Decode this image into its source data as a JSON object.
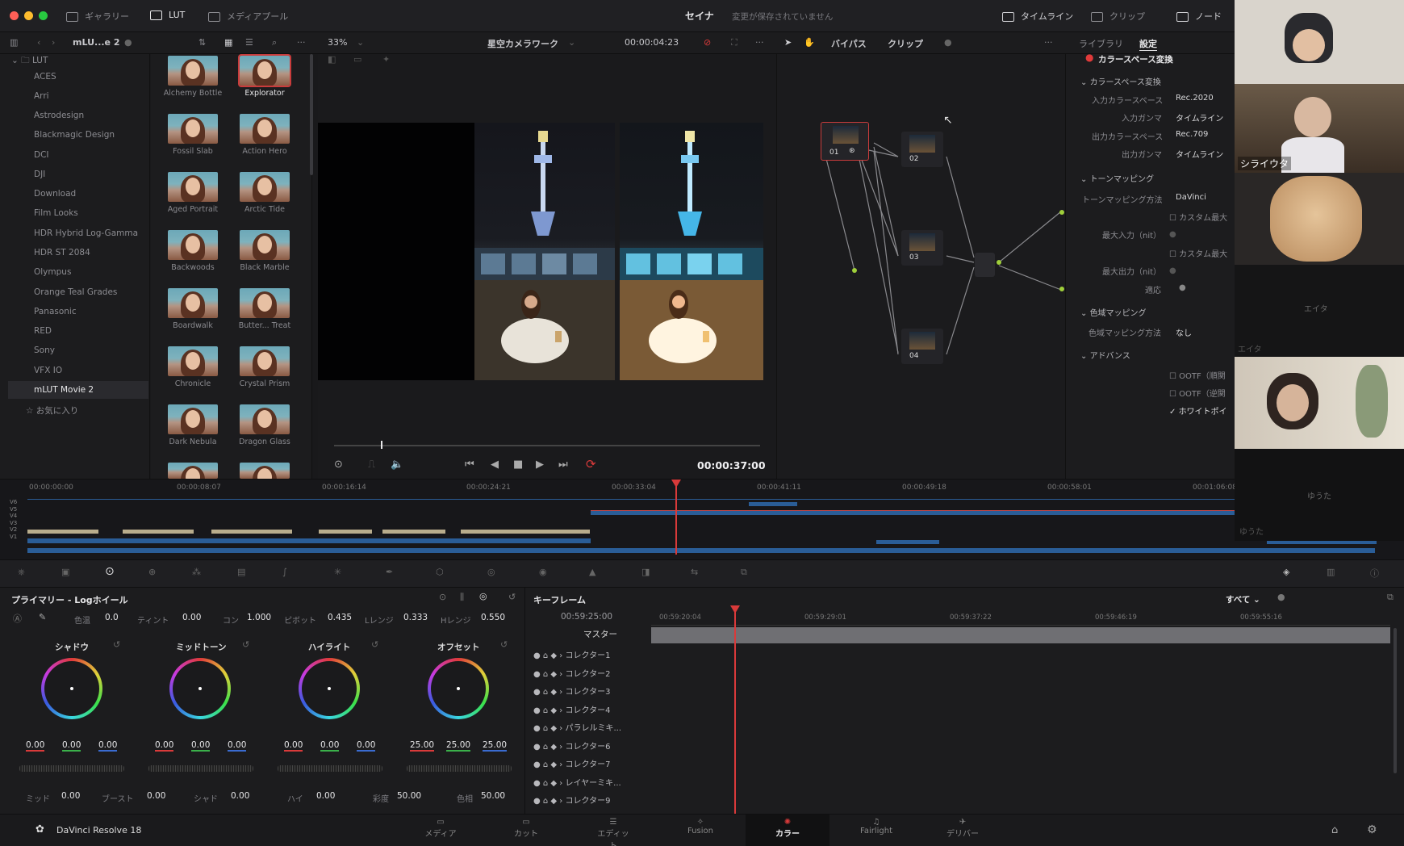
{
  "window": {
    "title": "セイナ",
    "save_status": "変更が保存されていません",
    "left_tabs": [
      "ギャラリー",
      "LUT",
      "メディアプール"
    ],
    "right_tabs": [
      "タイムライン",
      "クリップ",
      "ノード"
    ]
  },
  "subbar": {
    "project_short": "mLU...e 2",
    "zoom": "33%",
    "timeline_name": "星空カメラワーク",
    "timecode": "00:00:04:23",
    "bypass": "バイパス",
    "clip": "クリップ",
    "library_tab": "ライブラリ",
    "settings_tab": "設定"
  },
  "lut_tree": {
    "root": "LUT",
    "items": [
      "ACES",
      "Arri",
      "Astrodesign",
      "Blackmagic Design",
      "DCI",
      "DJI",
      "Download",
      "Film Looks",
      "HDR Hybrid Log-Gamma",
      "HDR ST 2084",
      "Olympus",
      "Orange Teal Grades",
      "Panasonic",
      "RED",
      "Sony",
      "VFX IO",
      "mLUT Movie 2"
    ],
    "favorites": "お気に入り",
    "selected": "mLUT Movie 2"
  },
  "lut_grid": [
    [
      "Alchemy Bottle",
      "Explorator"
    ],
    [
      "Fossil Slab",
      "Action Hero"
    ],
    [
      "Aged Portrait",
      "Arctic Tide"
    ],
    [
      "Backwoods",
      "Black Marble"
    ],
    [
      "Boardwalk",
      "Butter... Treat"
    ],
    [
      "Chronicle",
      "Crystal Prism"
    ],
    [
      "Dark Nebula",
      "Dragon Glass"
    ]
  ],
  "viewer": {
    "timecode": "00:00:37:00"
  },
  "nodes": [
    "01",
    "02",
    "03",
    "04"
  ],
  "settings_panel": {
    "header": "カラースペース変換",
    "section_csc": "カラースペース変換",
    "input_cs_label": "入力カラースペース",
    "input_cs_value": "Rec.2020",
    "input_gamma_label": "入力ガンマ",
    "input_gamma_value": "タイムライン",
    "output_cs_label": "出力カラースペース",
    "output_cs_value": "Rec.709",
    "output_gamma_label": "出力ガンマ",
    "output_gamma_value": "タイムライン",
    "section_tone": "トーンマッピング",
    "tone_method_label": "トーンマッピング方法",
    "tone_method_value": "DaVinci",
    "custom_max_in": "カスタム最大",
    "max_in_label": "最大入力（nit）",
    "custom_max_out": "カスタム最大",
    "max_out_label": "最大出力（nit）",
    "adapt_label": "適応",
    "section_gamut": "色域マッピング",
    "gamut_method_label": "色域マッピング方法",
    "gamut_method_value": "なし",
    "section_adv": "アドバンス",
    "ootf1": "OOTF（順関",
    "ootf2": "OOTF（逆関",
    "white_point": "ホワイトポイ"
  },
  "timeline": {
    "ruler": [
      "00:00:00:00",
      "00:00:08:07",
      "00:00:16:14",
      "00:00:24:21",
      "00:00:33:04",
      "00:00:41:11",
      "00:00:49:18",
      "00:00:58:01",
      "00:01:06:08"
    ],
    "tracks": [
      "V6",
      "V5",
      "V4",
      "V3",
      "V2",
      "V1"
    ]
  },
  "primaries": {
    "title": "プライマリー - Logホイール",
    "params": [
      {
        "label": "色温",
        "value": "0.0"
      },
      {
        "label": "ティント",
        "value": "0.00"
      },
      {
        "label": "コン",
        "value": "1.000"
      },
      {
        "label": "ピボット",
        "value": "0.435"
      },
      {
        "label": "Lレンジ",
        "value": "0.333"
      },
      {
        "label": "Hレンジ",
        "value": "0.550"
      }
    ],
    "wheels": [
      {
        "name": "シャドウ",
        "values": [
          "0.00",
          "0.00",
          "0.00"
        ]
      },
      {
        "name": "ミッドトーン",
        "values": [
          "0.00",
          "0.00",
          "0.00"
        ]
      },
      {
        "name": "ハイライト",
        "values": [
          "0.00",
          "0.00",
          "0.00"
        ]
      },
      {
        "name": "オフセット",
        "values": [
          "25.00",
          "25.00",
          "25.00"
        ]
      }
    ],
    "bottom": [
      {
        "label": "ミッド",
        "value": "0.00"
      },
      {
        "label": "ブースト",
        "value": "0.00"
      },
      {
        "label": "シャド",
        "value": "0.00"
      },
      {
        "label": "ハイ",
        "value": "0.00"
      },
      {
        "label": "彩度",
        "value": "50.00"
      },
      {
        "label": "色相",
        "value": "50.00"
      }
    ]
  },
  "keyframes": {
    "title": "キーフレーム",
    "filter": "すべて",
    "timecode": "00:59:25:00",
    "ruler": [
      "00:59:20:04",
      "00:59:29:01",
      "00:59:37:22",
      "00:59:46:19",
      "00:59:55:16"
    ],
    "master": "マスター",
    "rows": [
      "コレクター1",
      "コレクター2",
      "コレクター3",
      "コレクター4",
      "パラレルミキ...",
      "コレクター6",
      "コレクター7",
      "レイヤーミキ...",
      "コレクター9"
    ]
  },
  "pages": {
    "app_name": "DaVinci Resolve 18",
    "tabs": [
      "メディア",
      "カット",
      "エディット",
      "Fusion",
      "カラー",
      "Fairlight",
      "デリバー"
    ],
    "active": "カラー"
  },
  "participants": {
    "p2_name": "シライウタ",
    "n1": "エイタ",
    "n2": "エイタ",
    "n3": "ゆうた",
    "n4": "ゆうた"
  },
  "colors": {
    "accent_red": "#d93a3a",
    "clip_blue": "#2a5d97",
    "clip_tan": "#b9ad8c"
  }
}
